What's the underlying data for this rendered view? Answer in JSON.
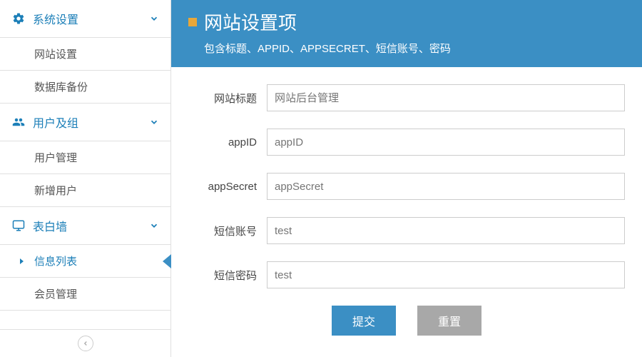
{
  "sidebar": {
    "sections": [
      {
        "icon": "gear",
        "label": "系统设置",
        "items": [
          "网站设置",
          "数据库备份"
        ]
      },
      {
        "icon": "users",
        "label": "用户及组",
        "items": [
          "用户管理",
          "新增用户"
        ]
      },
      {
        "icon": "monitor",
        "label": "表白墙",
        "items": [
          "信息列表",
          "会员管理"
        ],
        "activeItem": 0
      }
    ]
  },
  "banner": {
    "title": "网站设置项",
    "subtitle": "包含标题、APPID、APPSECRET、短信账号、密码"
  },
  "form": {
    "rows": [
      {
        "label": "网站标题",
        "value": "",
        "placeholder": "网站后台管理"
      },
      {
        "label": "appID",
        "value": "",
        "placeholder": "appID"
      },
      {
        "label": "appSecret",
        "value": "",
        "placeholder": "appSecret"
      },
      {
        "label": "短信账号",
        "value": "",
        "placeholder": "test"
      },
      {
        "label": "短信密码",
        "value": "",
        "placeholder": "test"
      }
    ],
    "submit": "提交",
    "reset": "重置"
  }
}
